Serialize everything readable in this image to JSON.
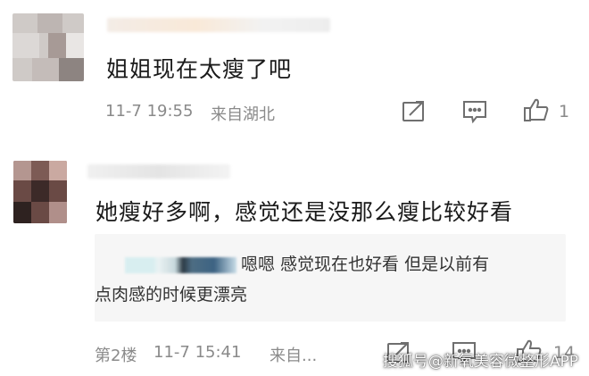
{
  "comments": [
    {
      "text": "姐姐现在太瘦了吧",
      "date": "11-7 19:55",
      "location": "来自湖北",
      "likes": "1"
    },
    {
      "text": "她瘦好多啊，感觉还是没那么瘦比较好看",
      "reply_line1": "嗯嗯 感觉现在也好看 但是以前有",
      "reply_line2": "点肉感的时候更漂亮",
      "floor": "第2楼",
      "date": "11-7 15:41",
      "location": "来自...",
      "likes": "14"
    }
  ],
  "watermark": "搜狐号@新氧美容微整形APP",
  "icons": [
    "share-icon",
    "comment-icon",
    "like-icon"
  ],
  "colors": {
    "meta_text": "#8a8a8a",
    "reply_bg": "#f6f6f6",
    "body_text": "#1a1a1a"
  }
}
